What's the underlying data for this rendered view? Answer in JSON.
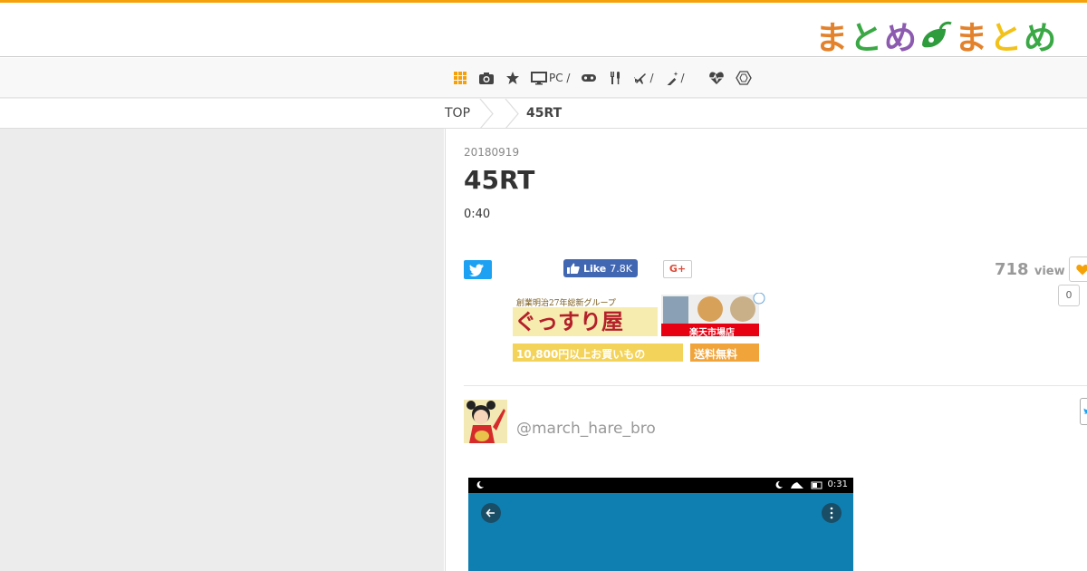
{
  "site": {
    "logo_chars": [
      "ま",
      "と",
      "め",
      "ま",
      "と",
      "め"
    ],
    "accent_color": "#f5a20a"
  },
  "nav": {
    "items": [
      {
        "icon": "grid-icon",
        "label": ""
      },
      {
        "icon": "camera-icon",
        "label": ""
      },
      {
        "icon": "star-icon",
        "label": ""
      },
      {
        "icon": "monitor-icon",
        "label": "PC /"
      },
      {
        "icon": "gamepad-icon",
        "label": ""
      },
      {
        "icon": "utensils-icon",
        "label": ""
      },
      {
        "icon": "airplane-icon",
        "label": "/"
      },
      {
        "icon": "magic-wand-icon",
        "label": "/"
      },
      {
        "icon": "heartbeat-icon",
        "label": ""
      },
      {
        "icon": "hexagon-icon",
        "label": ""
      }
    ]
  },
  "breadcrumb": {
    "top": "TOP",
    "current": "45RT"
  },
  "article": {
    "date": "20180919",
    "title": "45RT",
    "duration": "0:40",
    "fb_like_label": "Like",
    "fb_like_count": "7.8K",
    "gplus_label": "G+",
    "views": "718",
    "views_unit": "view",
    "fav_count": "0",
    "author": "@march_hare_bro"
  },
  "ad": {
    "line1": "創業明治27年総新グループ",
    "shop_name": "ぐっすり屋",
    "market": "楽天市場店",
    "offer": "10,800円以上お買いもの",
    "free_shipping": "送料無料"
  },
  "embed": {
    "time": "0:31"
  }
}
